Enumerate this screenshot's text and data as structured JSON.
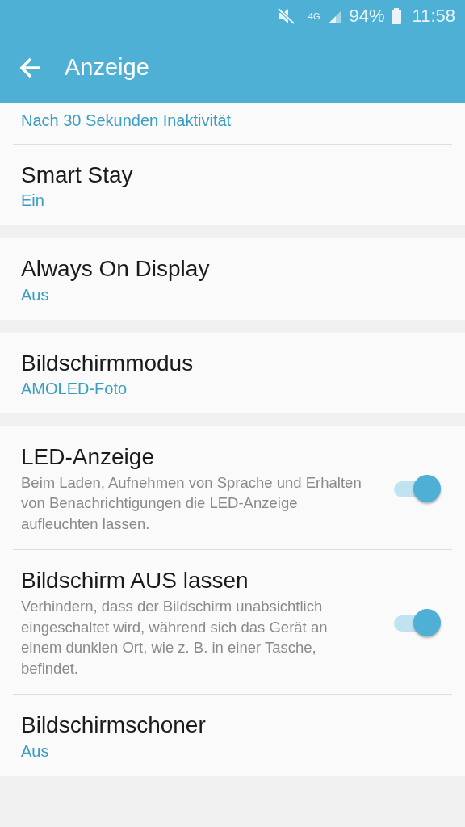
{
  "status_bar": {
    "network": "4G",
    "battery": "94%",
    "time": "11:58"
  },
  "app_bar": {
    "title": "Anzeige"
  },
  "groups": [
    [
      {
        "kind": "value",
        "value": "Nach 30 Sekunden Inaktivität"
      },
      {
        "kind": "value",
        "title": "Smart Stay",
        "value": "Ein"
      }
    ],
    [
      {
        "kind": "value",
        "title": "Always On Display",
        "value": "Aus"
      }
    ],
    [
      {
        "kind": "value",
        "title": "Bildschirmmodus",
        "value": "AMOLED-Foto"
      }
    ],
    [
      {
        "kind": "toggle",
        "title": "LED-Anzeige",
        "description": "Beim Laden, Aufnehmen von Sprache und Erhalten von Benachrichtigungen die LED-Anzeige aufleuchten lassen.",
        "on": true
      },
      {
        "kind": "toggle",
        "title": "Bildschirm AUS lassen",
        "description": "Verhindern, dass der Bildschirm unabsichtlich eingeschaltet wird, während sich das Gerät an einem dunklen Ort, wie z. B. in einer Tasche, befindet.",
        "on": true
      },
      {
        "kind": "value",
        "title": "Bildschirmschoner",
        "value": "Aus"
      }
    ]
  ]
}
